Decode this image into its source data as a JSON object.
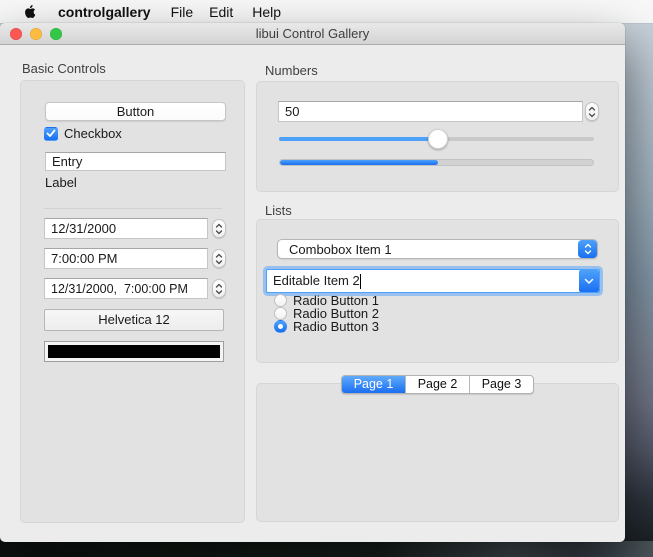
{
  "menu_bar": {
    "app_name": "controlgallery",
    "items": [
      "File",
      "Edit",
      "Help"
    ]
  },
  "window": {
    "title": "libui Control Gallery",
    "traffic_lights": {
      "close": "#fc5753",
      "minimize": "#fdbc40",
      "zoom": "#33c748"
    }
  },
  "basic_controls": {
    "group_label": "Basic Controls",
    "button_label": "Button",
    "checkbox_label": "Checkbox",
    "checkbox_checked": true,
    "entry_value": "Entry",
    "label_text": "Label",
    "date_value": "12/31/2000",
    "time_value": "7:00:00 PM",
    "datetime_value": "12/31/2000,  7:00:00 PM",
    "font_button_label": "Helvetica 12",
    "color_value": "#000000"
  },
  "numbers": {
    "group_label": "Numbers",
    "spinbox_value": "50",
    "slider_percent": 50.5,
    "progress_percent": 50.5
  },
  "lists": {
    "group_label": "Lists",
    "combobox_value": "Combobox Item 1",
    "editable_combobox_value": "Editable Item 2",
    "radios": [
      {
        "label": "Radio Button 1",
        "selected": false
      },
      {
        "label": "Radio Button 2",
        "selected": false
      },
      {
        "label": "Radio Button 3",
        "selected": true
      }
    ]
  },
  "tabs": {
    "items": [
      {
        "label": "Page 1",
        "selected": true
      },
      {
        "label": "Page 2",
        "selected": false
      },
      {
        "label": "Page 3",
        "selected": false
      }
    ]
  },
  "colors": {
    "accent": "#4da1fa",
    "accent_deep": "#1a6ff2"
  }
}
